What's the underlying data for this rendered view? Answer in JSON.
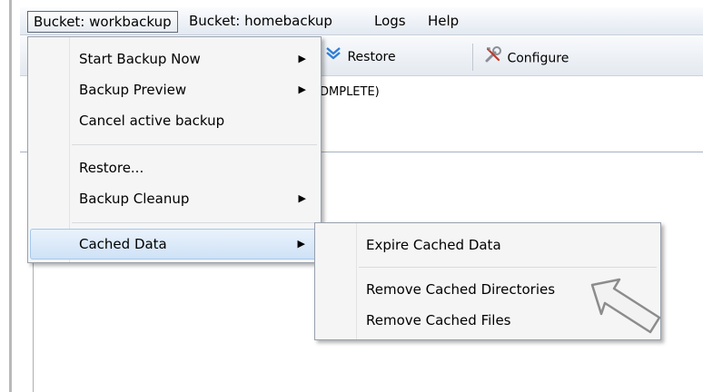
{
  "menubar": {
    "items": [
      {
        "label": "Bucket: workbackup"
      },
      {
        "label": "Bucket: homebackup"
      },
      {
        "label": "Logs"
      },
      {
        "label": "Help"
      }
    ]
  },
  "toolbar": {
    "restore_label": "Restore",
    "configure_label": "Configure"
  },
  "status": {
    "text": "DMPLETE)"
  },
  "bucket_menu": {
    "items": [
      {
        "label": "Start Backup Now",
        "submenu": true
      },
      {
        "label": "Backup Preview",
        "submenu": true
      },
      {
        "label": "Cancel active backup",
        "submenu": false
      },
      {
        "label": "Restore...",
        "submenu": false
      },
      {
        "label": "Backup Cleanup",
        "submenu": true
      },
      {
        "label": "Cached Data",
        "submenu": true,
        "highlighted": true
      }
    ]
  },
  "cached_menu": {
    "items": [
      {
        "label": "Expire Cached Data"
      },
      {
        "label": "Remove Cached Directories"
      },
      {
        "label": "Remove Cached Files"
      }
    ]
  },
  "colors": {
    "highlight": "#cfe2f6",
    "highlight_border": "#a5c7ec",
    "menu_bg": "#f5f5f5",
    "menubar_bg": "#e3e9f2",
    "restore_icon": "#2f7fd6",
    "configure_icon": "#8a8f96"
  },
  "icons": {
    "submenu_arrow": "chevron-right-icon",
    "restore": "restore-icon",
    "configure": "configure-icon",
    "cursor": "pointer-arrow-icon"
  }
}
